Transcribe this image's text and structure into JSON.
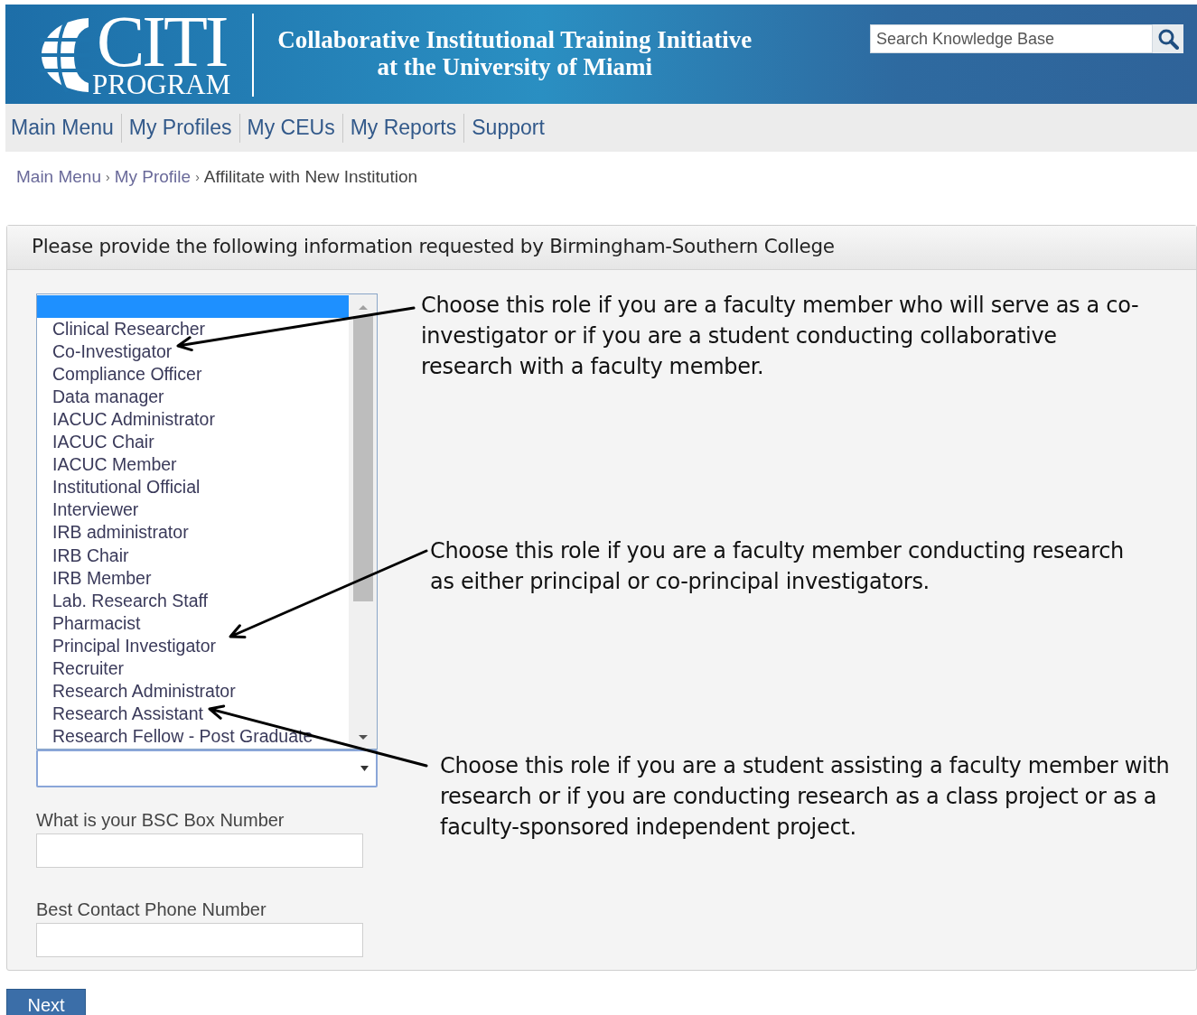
{
  "header": {
    "logo": {
      "wordmark": "CITI",
      "subtitle": "PROGRAM"
    },
    "title_lines": [
      "Collaborative Institutional Training Initiative",
      "at the University of Miami"
    ],
    "search": {
      "placeholder": "Search Knowledge Base"
    }
  },
  "nav": [
    "Main Menu",
    "My Profiles",
    "My CEUs",
    "My Reports",
    "Support"
  ],
  "breadcrumb": [
    {
      "label": "Main Menu",
      "link": true,
      "separator": "›"
    },
    {
      "label": "My Profile",
      "link": true,
      "separator": "›"
    },
    {
      "label": "Affilitate with New Institution",
      "link": false
    }
  ],
  "panel": {
    "title": "Please provide the following information requested by Birmingham-Southern College",
    "role_list": {
      "options": [
        {
          "selected": true
        },
        {
          "label": "Clinical Researcher",
          "selected": false
        },
        {
          "label": "Co-Investigator",
          "selected": false
        },
        {
          "label": "Compliance Officer",
          "selected": false
        },
        {
          "label": "Data manager",
          "selected": false
        },
        {
          "label": "IACUC Administrator",
          "selected": false
        },
        {
          "label": "IACUC Chair",
          "selected": false
        },
        {
          "label": "IACUC Member",
          "selected": false
        },
        {
          "label": "Institutional Official",
          "selected": false
        },
        {
          "label": "Interviewer",
          "selected": false
        },
        {
          "label": "IRB administrator",
          "selected": false
        },
        {
          "label": "IRB Chair",
          "selected": false
        },
        {
          "label": "IRB Member",
          "selected": false
        },
        {
          "label": "Lab. Research Staff",
          "selected": false
        },
        {
          "label": "Pharmacist",
          "selected": false
        },
        {
          "label": "Principal Investigator",
          "selected": false
        },
        {
          "label": "Recruiter",
          "selected": false
        },
        {
          "label": "Research Administrator",
          "selected": false
        },
        {
          "label": "Research Assistant",
          "selected": false
        },
        {
          "label": "Research Fellow - Post Graduate",
          "selected": false
        }
      ]
    },
    "fields": [
      {
        "label": "What is your BSC Box Number"
      },
      {
        "label": "Best Contact Phone Number"
      }
    ],
    "next_button": "Next"
  },
  "annotations": [
    {
      "text": "Choose this role if you are a faculty member who will serve as a co-investigator or if you are a student conducting collaborative research with a faculty member."
    },
    {
      "text": "Choose this role if you are a faculty member conducting research as either principal or co-principal investigators."
    },
    {
      "text": "Choose this role if you are a student assisting a faculty member with research or if you are conducting research as a class project or as a faculty-sponsored independent project."
    }
  ]
}
